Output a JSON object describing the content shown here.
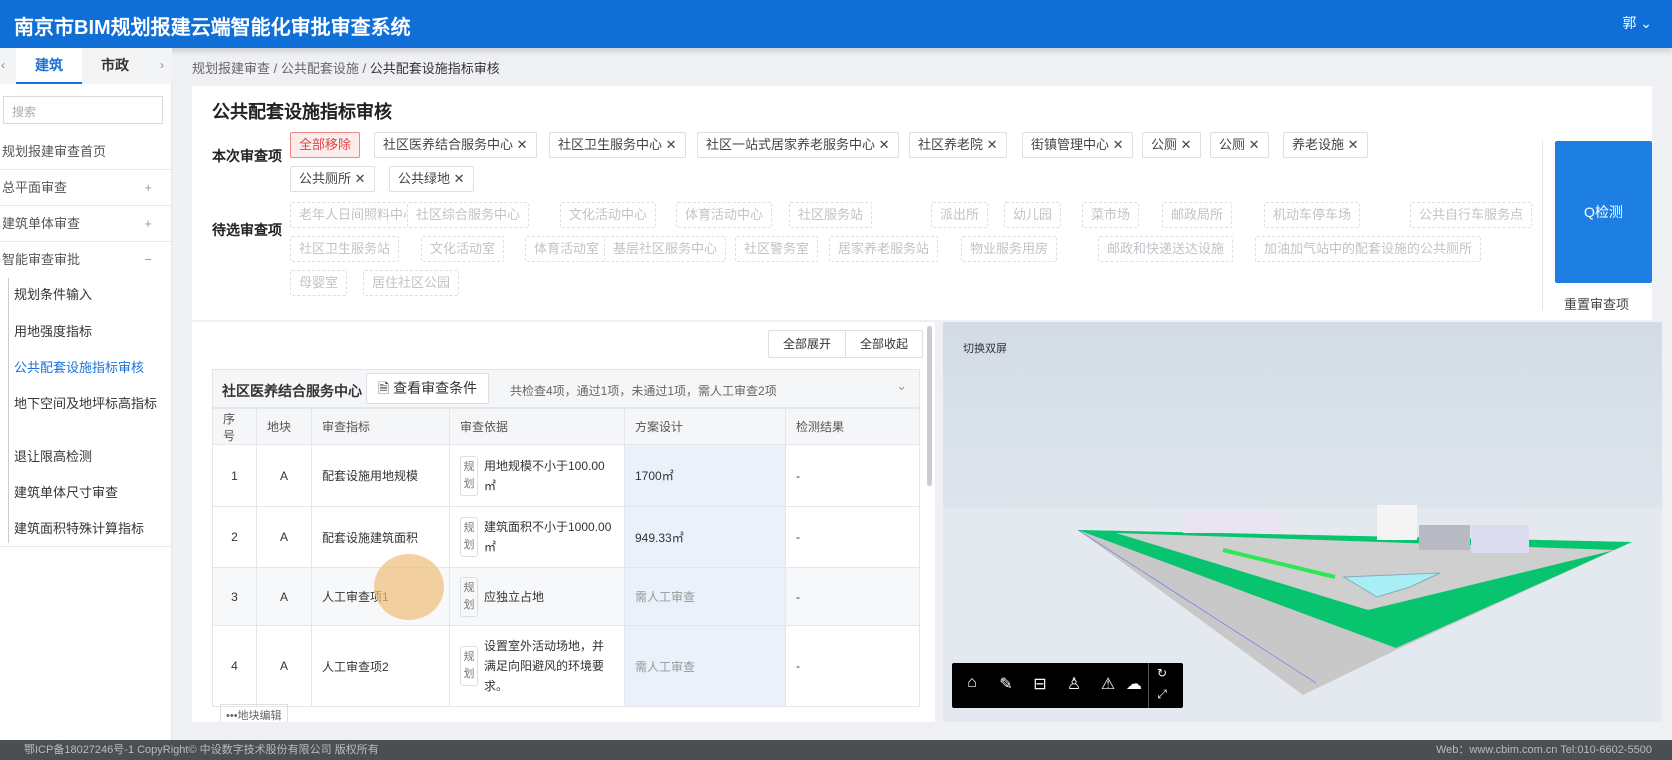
{
  "header": {
    "title": "南京市BIM规划报建云端智能化审批审查系统",
    "user": "郭"
  },
  "sidebar": {
    "tabs": [
      "建筑",
      "市政"
    ],
    "search_placeholder": "搜索",
    "items": [
      {
        "label": "规划报建审查首页",
        "toggle": ""
      },
      {
        "label": "总平面审查",
        "toggle": "+"
      },
      {
        "label": "建筑单体审查",
        "toggle": "+"
      },
      {
        "label": "智能审查审批",
        "toggle": "−"
      }
    ],
    "subitems": [
      "规划条件输入",
      "用地强度指标",
      "公共配套设施指标审核",
      "地下空间及地坪标高指标",
      "退让限高检测",
      "建筑单体尺寸审查",
      "建筑面积特殊计算指标"
    ]
  },
  "breadcrumb": [
    "规划报建审查",
    "公共配套设施",
    "公共配套设施指标审核"
  ],
  "page_title": "公共配套设施指标审核",
  "current": {
    "label": "本次审查项",
    "remove_all": "全部移除",
    "tags": [
      "社区医养结合服务中心",
      "社区卫生服务中心",
      "社区一站式居家养老服务中心",
      "社区养老院",
      "街镇管理中心",
      "公厕",
      "公厕",
      "养老设施",
      "公共厕所",
      "公共绿地"
    ]
  },
  "pending": {
    "label": "待选审查项",
    "tags": [
      "老年人日间照料中心",
      "社区综合服务中心",
      "文化活动中心",
      "体育活动中心",
      "社区服务站",
      "派出所",
      "幼儿园",
      "菜市场",
      "邮政局所",
      "机动车停车场",
      "公共自行车服务点",
      "社区卫生服务站",
      "文化活动室",
      "体育活动室",
      "基层社区服务中心",
      "社区警务室",
      "居家养老服务站",
      "物业服务用房",
      "邮政和快递送达设施",
      "加油加气站中的配套设施的公共厕所",
      "母婴室",
      "居住社区公园"
    ]
  },
  "detect_button": "Q检测",
  "reset_button": "重置审查项",
  "results": {
    "expand_all": "全部展开",
    "collapse_all": "全部收起",
    "section": {
      "name": "社区医养结合服务中心",
      "view_conditions": "查看审查条件",
      "summary": "共检查4项，通过1项，未通过1项，需人工审查2项"
    },
    "columns": [
      "序号",
      "地块",
      "审查指标",
      "审查依据",
      "方案设计",
      "检测结果"
    ],
    "rows": [
      {
        "no": "1",
        "plot": "A",
        "index": "配套设施用地规模",
        "tag": "规划",
        "basis": "用地规模不小于100.00㎡",
        "design": "1700㎡",
        "result": "-"
      },
      {
        "no": "2",
        "plot": "A",
        "index": "配套设施建筑面积",
        "tag": "规划",
        "basis": "建筑面积不小于1000.00㎡",
        "design": "949.33㎡",
        "result": "-"
      },
      {
        "no": "3",
        "plot": "A",
        "index": "人工审查项1",
        "tag": "规划",
        "basis": "应独立占地",
        "design": "需人工审查",
        "result": "-"
      },
      {
        "no": "4",
        "plot": "A",
        "index": "人工审查项2",
        "tag": "规划",
        "basis": "设置室外活动场地，并满足向阳避风的环境要求。",
        "design": "需人工审查",
        "result": "-"
      }
    ],
    "more": "•••地块编辑"
  },
  "viewer": {
    "switch_label": "切换双屏",
    "toolbar": [
      "home-icon",
      "measure-icon",
      "section-icon",
      "person-icon",
      "roam-icon",
      "weather-icon",
      "rotate-icon",
      "fullscreen-icon"
    ]
  },
  "footer": {
    "left": "鄂ICP备18027246号-1 CopyRight© 中设数字技术股份有限公司 版权所有",
    "right": "Web：www.cbim.com.cn Tel:010-6602-5500"
  }
}
